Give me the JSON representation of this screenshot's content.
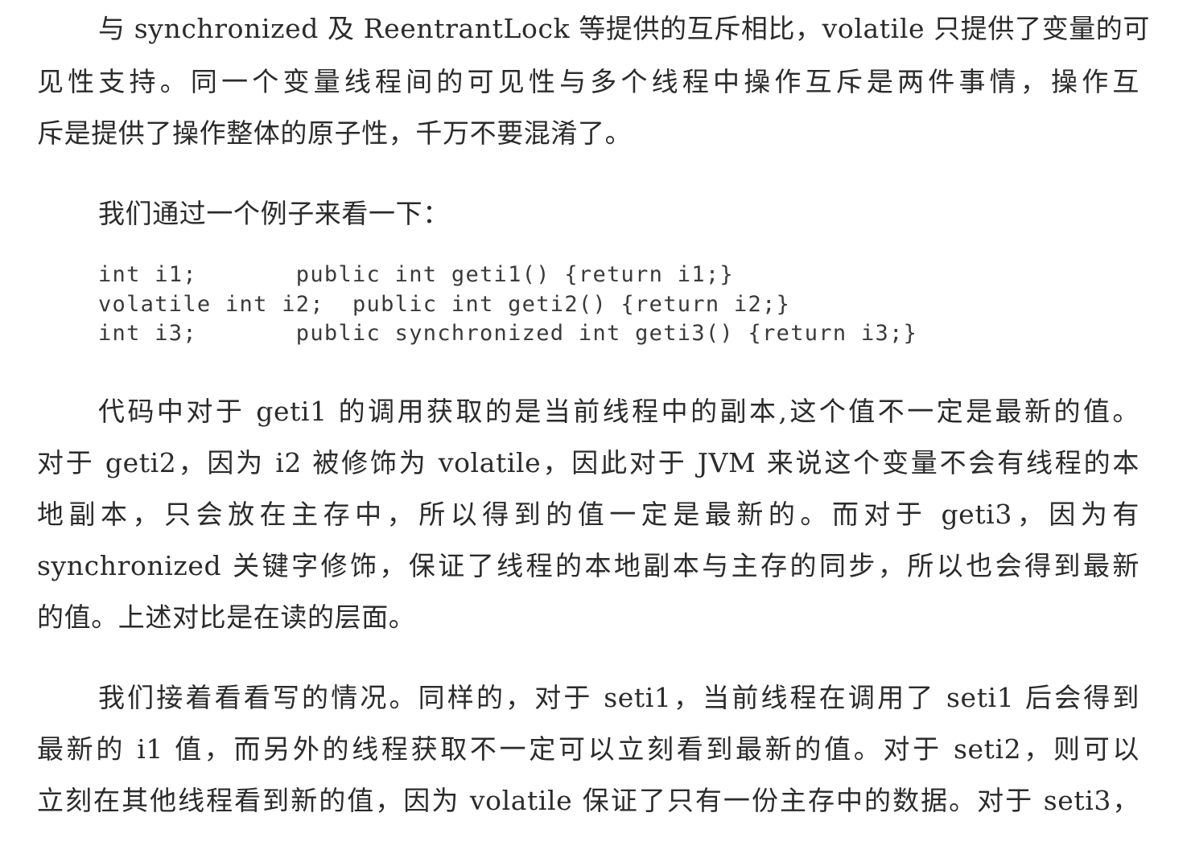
{
  "paragraph_1": {
    "line_1": "与 synchronized 及 ReentrantLock 等提供的互斥相比，volatile 只提供了变量的可",
    "line_2": "见性支持。同一个变量线程间的可见性与多个线程中操作互斥是两件事情，操作互",
    "line_3": "斥是提供了操作整体的原子性，千万不要混淆了。"
  },
  "paragraph_2": {
    "line_1": "我们通过一个例子来看一下："
  },
  "code_block": {
    "line_1": "int i1;       public int geti1() {return i1;}",
    "line_2": "volatile int i2;  public int geti2() {return i2;}",
    "line_3": "int i3;       public synchronized int geti3() {return i3;}"
  },
  "paragraph_3": {
    "line_1": "代码中对于 geti1 的调用获取的是当前线程中的副本,这个值不一定是最新的值。",
    "line_2": "对于 geti2，因为 i2 被修饰为 volatile，因此对于 JVM 来说这个变量不会有线程的本",
    "line_3": "地副本，只会放在主存中，所以得到的值一定是最新的。而对于 geti3，因为有",
    "line_4": "synchronized 关键字修饰，保证了线程的本地副本与主存的同步，所以也会得到最新",
    "line_5": "的值。上述对比是在读的层面。"
  },
  "paragraph_4": {
    "line_1": "我们接着看看写的情况。同样的，对于 seti1，当前线程在调用了 seti1 后会得到",
    "line_2": "最新的 i1 值，而另外的线程获取不一定可以立刻看到最新的值。对于 seti2，则可以",
    "line_3": "立刻在其他线程看到新的值，因为 volatile 保证了只有一份主存中的数据。对于 seti3，"
  }
}
